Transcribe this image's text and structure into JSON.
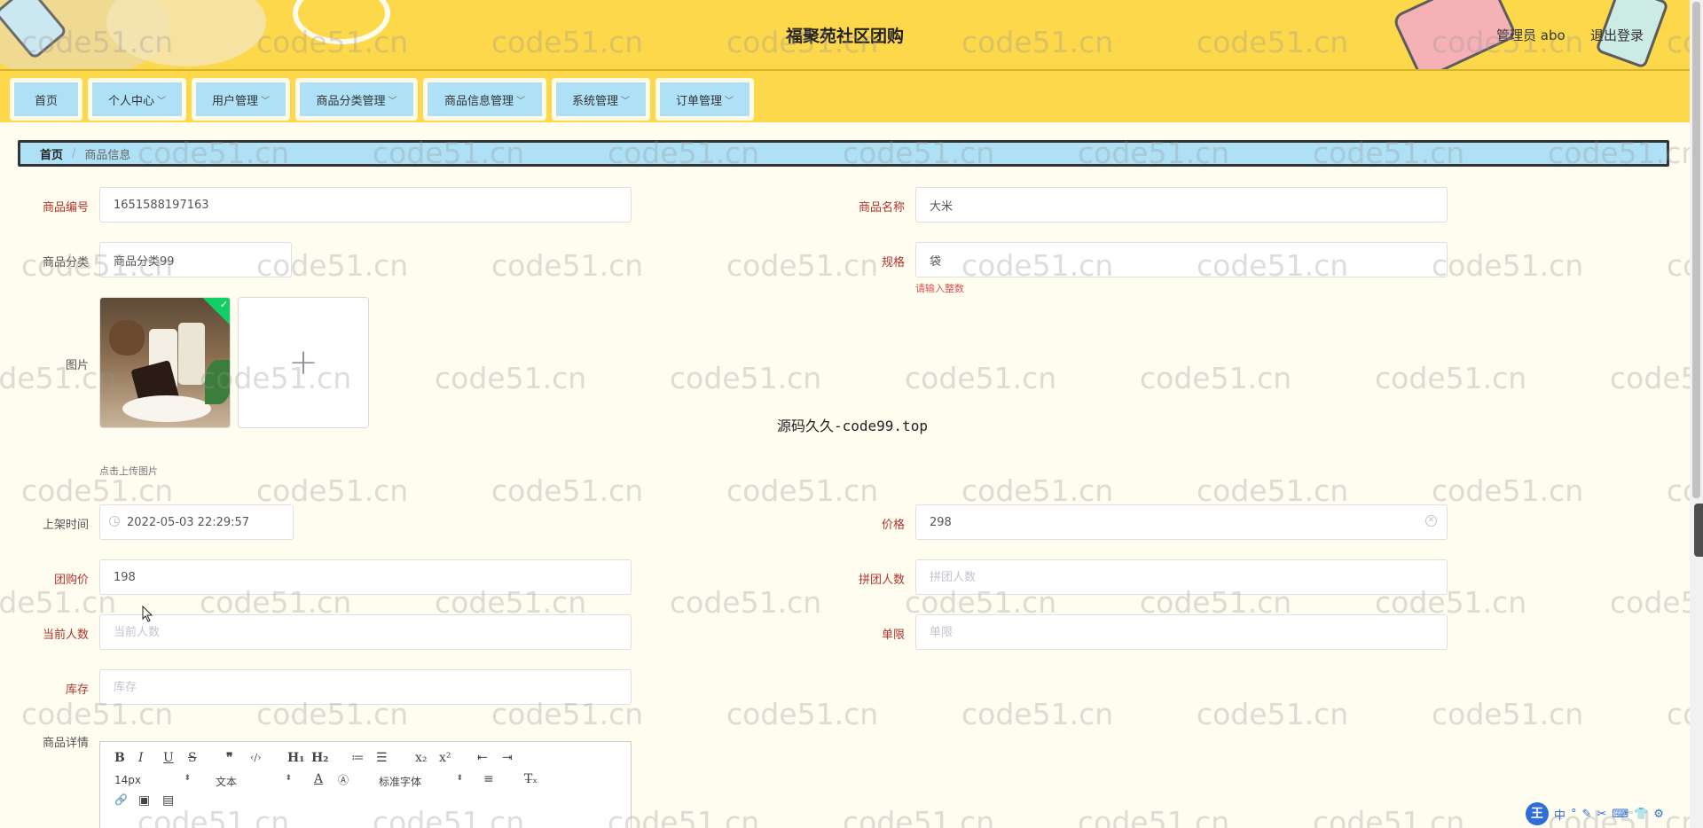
{
  "header": {
    "title": "福聚苑社区团购",
    "user_label": "管理员 abo",
    "logout_label": "退出登录"
  },
  "nav": {
    "items": [
      {
        "label": "首页",
        "has_dropdown": false
      },
      {
        "label": "个人中心",
        "has_dropdown": true
      },
      {
        "label": "用户管理",
        "has_dropdown": true
      },
      {
        "label": "商品分类管理",
        "has_dropdown": true
      },
      {
        "label": "商品信息管理",
        "has_dropdown": true
      },
      {
        "label": "系统管理",
        "has_dropdown": true
      },
      {
        "label": "订单管理",
        "has_dropdown": true
      }
    ],
    "dropdown_icon": "chevron-down-icon"
  },
  "breadcrumb": {
    "home": "首页",
    "separator": "/",
    "current": "商品信息"
  },
  "form": {
    "product_no": {
      "label": "商品编号",
      "value": "1651588197163"
    },
    "product_name": {
      "label": "商品名称",
      "value": "大米"
    },
    "category": {
      "label": "商品分类",
      "value": "商品分类99"
    },
    "spec": {
      "label": "规格",
      "value": "袋",
      "hint": "请输入整数"
    },
    "image": {
      "label": "图片",
      "tip": "点击上传图片",
      "upload_symbol": "+",
      "check_symbol": "✓"
    },
    "shelf_time": {
      "label": "上架时间",
      "value": "2022-05-03 22:29:57"
    },
    "price": {
      "label": "价格",
      "value": "298"
    },
    "group_price": {
      "label": "团购价",
      "value": "198"
    },
    "group_size": {
      "label": "拼团人数",
      "placeholder": "拼团人数"
    },
    "current_count": {
      "label": "当前人数",
      "placeholder": "当前人数"
    },
    "single_limit": {
      "label": "单限",
      "placeholder": "单限"
    },
    "stock": {
      "label": "库存",
      "placeholder": "库存"
    },
    "detail": {
      "label": "商品详情"
    }
  },
  "editor": {
    "font_size": "14px",
    "block_type": "文本",
    "font_family": "标准字体",
    "buttons": [
      "B",
      "I",
      "U",
      "S",
      "❞",
      "‹/›",
      "H₁",
      "H₂",
      "≔",
      "☰",
      "x₂",
      "x²",
      "⇤",
      "⇥",
      "A",
      "Ⓐ",
      "≡",
      "T̶ₓ",
      "🔗",
      "▣",
      "▤"
    ]
  },
  "overlay": {
    "center_text": "源码久久-code99.top",
    "watermark": "code51.cn"
  },
  "ime": {
    "logo": "王",
    "items": [
      "中",
      "°",
      "✎",
      "✂",
      "⌨",
      "👕",
      "⚙"
    ]
  }
}
